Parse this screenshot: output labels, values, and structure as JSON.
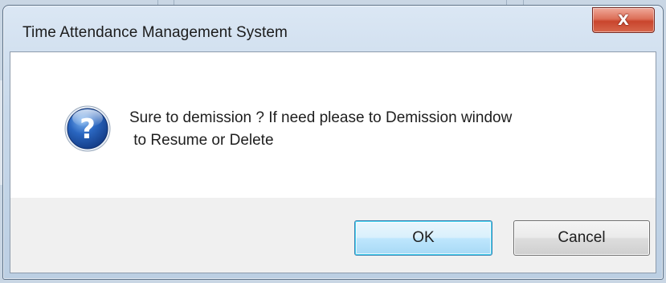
{
  "dialog": {
    "title": "Time Attendance Management System",
    "close_label": "X",
    "message_line1": "Sure to demission ? If need please to Demission window",
    "message_line2": " to Resume or Delete",
    "icon": "question-icon"
  },
  "buttons": {
    "ok_label": "OK",
    "cancel_label": "Cancel"
  },
  "colors": {
    "icon_fill": "#1f56a8",
    "close_button": "#c9452d",
    "focused_button_border": "#3c7fb1"
  }
}
